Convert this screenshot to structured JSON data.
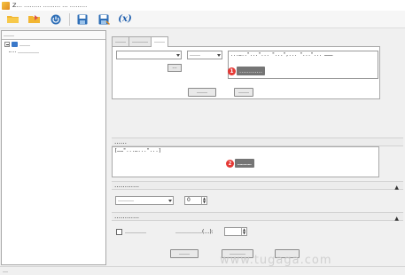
{
  "window": {
    "title": "Z… ……… ……… … ………"
  },
  "toolbar": {
    "items": [
      {
        "icon": "open-folder-icon"
      },
      {
        "icon": "export-icon"
      },
      {
        "icon": "power-icon"
      },
      {
        "icon": "save-icon"
      },
      {
        "icon": "save-as-icon"
      },
      {
        "icon": "function-icon",
        "label": "(x)"
      }
    ]
  },
  "left_panel": {
    "header": "……",
    "tree": [
      {
        "label": "……"
      },
      {
        "label": "…………"
      }
    ]
  },
  "tabs": [
    {
      "label": "……"
    },
    {
      "label": "………"
    },
    {
      "label": "……"
    }
  ],
  "params": {
    "combo1_value": "",
    "combo2_value": "……",
    "insert_button": "…",
    "code_text": "...…..\"...\"... \"...\",... \"...\"...\n………"
  },
  "annotations": {
    "step1_number": "1",
    "step1_label": "…………",
    "step2_number": "2",
    "step2_label": "…………"
  },
  "actions": {
    "btn_left": "……",
    "btn_right": "……"
  },
  "return_value": {
    "header": "……",
    "text": "[……\"...…...\"...]"
  },
  "control_target": {
    "header": "…………",
    "combo_value": "………",
    "spin_value": "0"
  },
  "operation_done": {
    "header": "…………",
    "checkbox_label": "…………",
    "spin_label": "……………(…):",
    "spin_value": ""
  },
  "footer": {
    "btn1": "……",
    "btn2": "………",
    "btn3": ""
  },
  "status": {
    "text": "…"
  },
  "watermark": "www.tugaga.com",
  "colors": {
    "accent": "#1f5fae",
    "annotation_red": "#e53935",
    "annotation_label_bg": "#757575"
  }
}
